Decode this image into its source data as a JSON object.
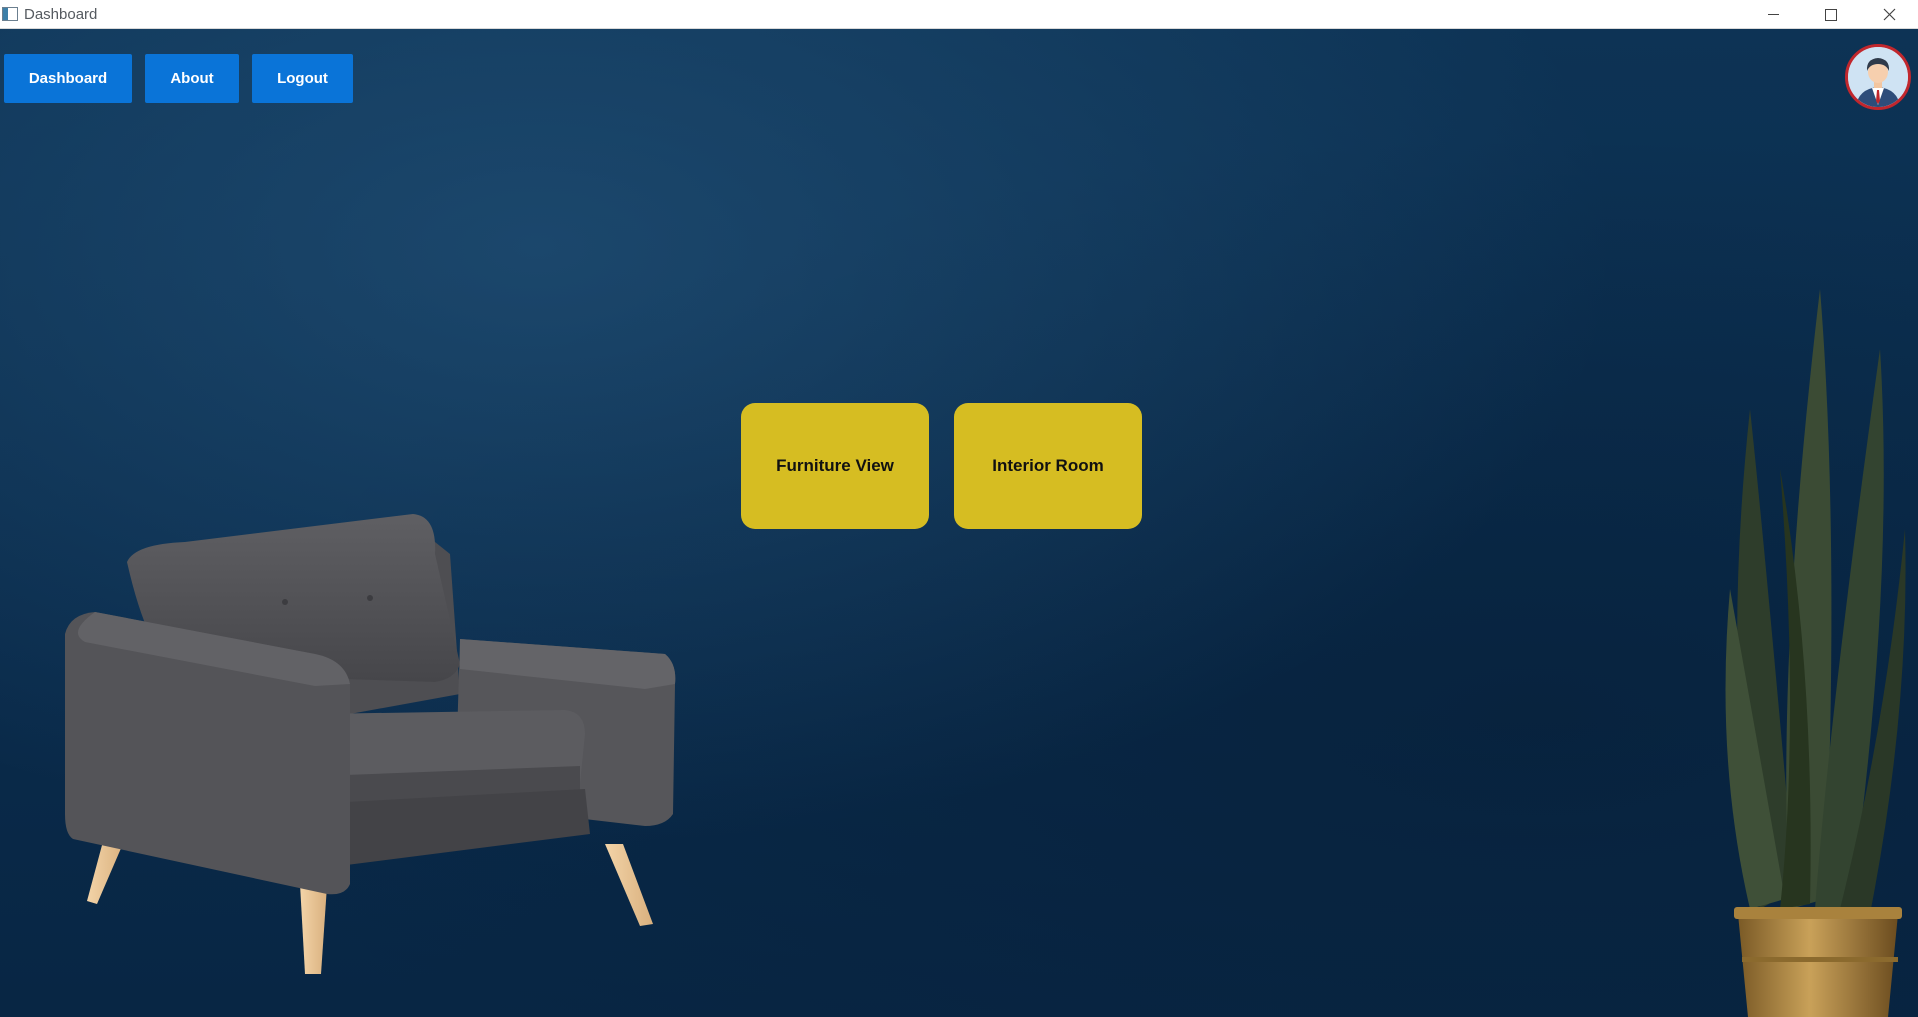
{
  "window": {
    "title": "Dashboard",
    "icon": "app-window-icon",
    "controls": [
      "minimize-icon",
      "maximize-icon",
      "close-icon"
    ]
  },
  "nav": {
    "dashboard_label": "Dashboard",
    "about_label": "About",
    "logout_label": "Logout"
  },
  "profile": {
    "icon": "user-avatar-icon"
  },
  "actions": {
    "furniture_view_label": "Furniture View",
    "interior_room_label": "Interior Room"
  },
  "decor": {
    "chair": "armchair-image",
    "plant": "snake-plant-image"
  },
  "colors": {
    "background": "#0b2d4d",
    "nav_button": "#0a74d8",
    "action_button": "#d6bd22",
    "avatar_border": "#c1272d"
  }
}
